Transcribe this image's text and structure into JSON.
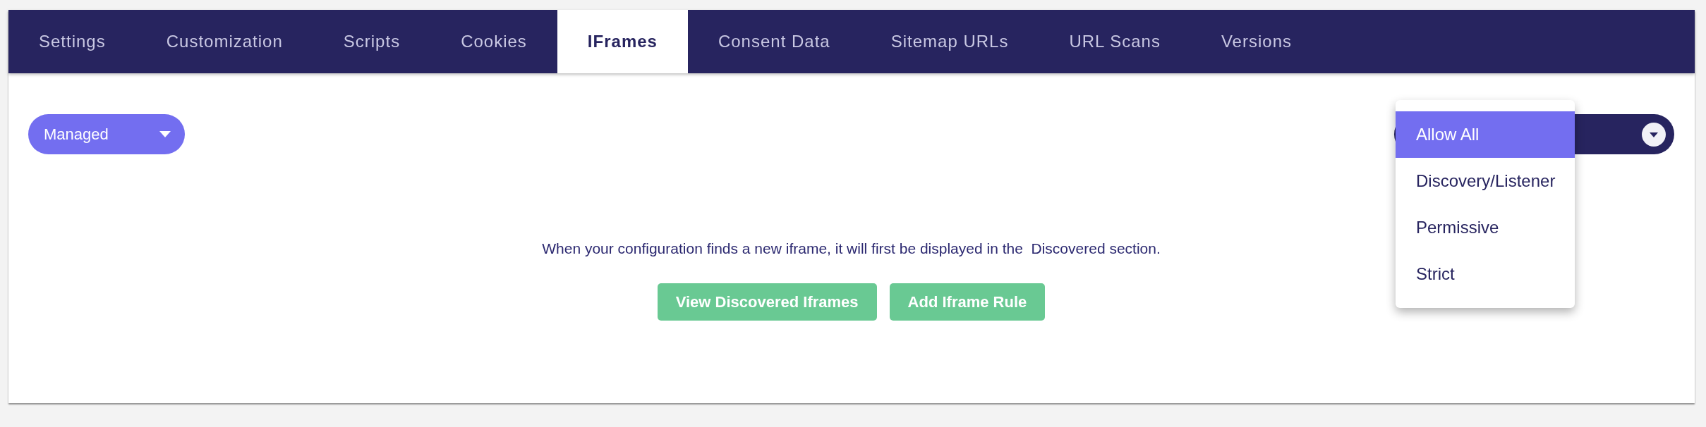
{
  "tabs": [
    {
      "label": "Settings",
      "selected": false
    },
    {
      "label": "Customization",
      "selected": false
    },
    {
      "label": "Scripts",
      "selected": false
    },
    {
      "label": "Cookies",
      "selected": false
    },
    {
      "label": "IFrames",
      "selected": true
    },
    {
      "label": "Consent Data",
      "selected": false
    },
    {
      "label": "Sitemap URLs",
      "selected": false
    },
    {
      "label": "URL Scans",
      "selected": false
    },
    {
      "label": "Versions",
      "selected": false
    }
  ],
  "mode_select": {
    "value": "Managed"
  },
  "policy_select": {
    "expanded": true,
    "options": [
      {
        "label": "Allow All",
        "selected": true
      },
      {
        "label": "Discovery/Listener",
        "selected": false
      },
      {
        "label": "Permissive",
        "selected": false
      },
      {
        "label": "Strict",
        "selected": false
      }
    ]
  },
  "empty_state": {
    "message": "When your configuration finds a new iframe, it will first be displayed in the  Discovered section.",
    "buttons": [
      "View Discovered Iframes",
      "Add Iframe Rule"
    ]
  }
}
